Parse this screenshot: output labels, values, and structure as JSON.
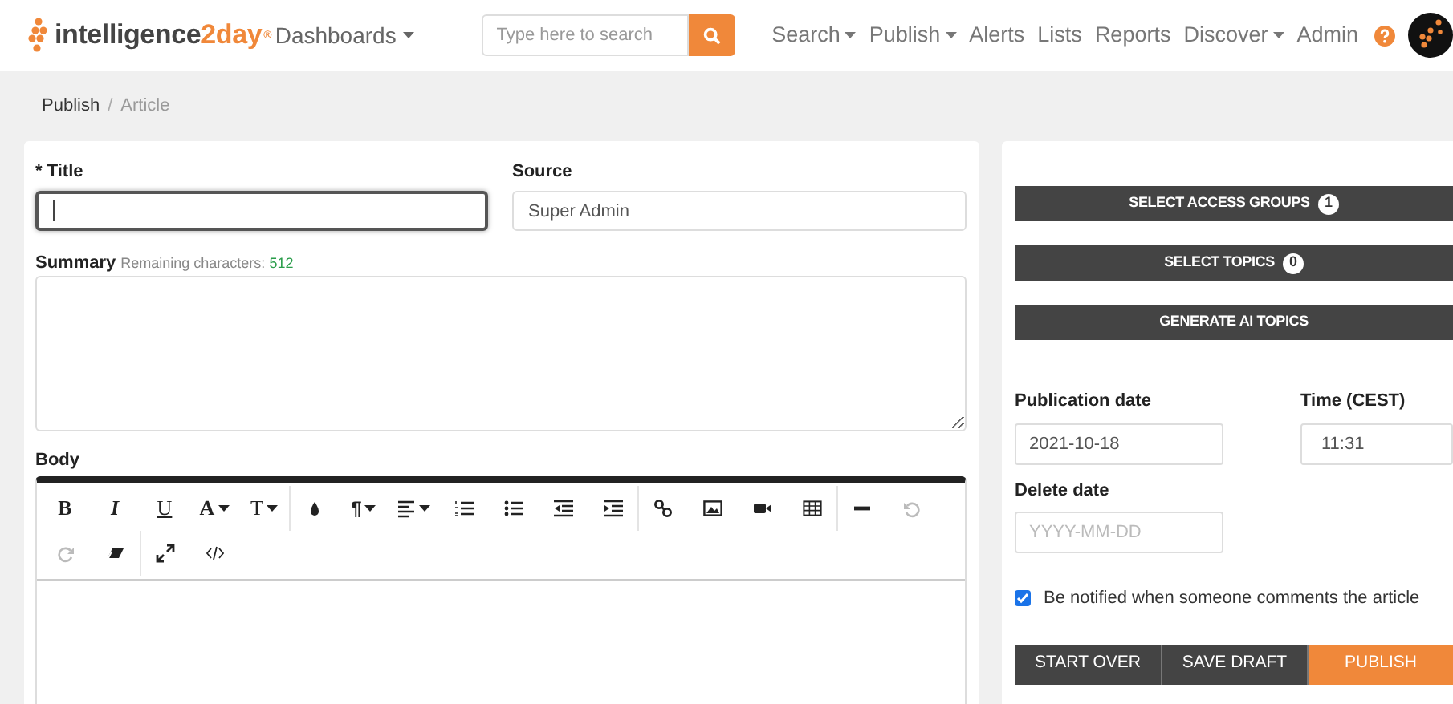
{
  "header": {
    "logo": {
      "text": "intelligence",
      "accent": "2day",
      "mark": "®"
    },
    "dashboards": {
      "label": "Dashboards",
      "dropdown": true
    },
    "search": {
      "placeholder": "Type here to search"
    },
    "nav": [
      {
        "label": "Search",
        "dropdown": true
      },
      {
        "label": "Publish",
        "dropdown": true
      },
      {
        "label": "Alerts",
        "dropdown": false
      },
      {
        "label": "Lists",
        "dropdown": false
      },
      {
        "label": "Reports",
        "dropdown": false
      },
      {
        "label": "Discover",
        "dropdown": true
      },
      {
        "label": "Admin",
        "dropdown": false
      }
    ]
  },
  "breadcrumb": {
    "separator": "/",
    "items": [
      {
        "label": "Publish",
        "current": false
      },
      {
        "label": "Article",
        "current": true
      }
    ]
  },
  "form": {
    "title": {
      "label": "* Title",
      "focused": true
    },
    "source": {
      "label": "Source",
      "value": "Super Admin"
    },
    "summary": {
      "label": "Summary",
      "hint": "Remaining characters:",
      "count": "512"
    },
    "body": {
      "label": "Body",
      "toolbar": [
        [
          {
            "kind": "bold",
            "glyph": "B",
            "dropdown": false,
            "disabled": false
          },
          {
            "kind": "italic",
            "glyph": "I",
            "dropdown": false,
            "disabled": false
          },
          {
            "kind": "underline",
            "glyph": "U",
            "dropdown": false,
            "disabled": false
          },
          {
            "kind": "fontcolor",
            "glyph": "A",
            "dropdown": true,
            "disabled": false
          },
          {
            "kind": "fontsize",
            "glyph": "T",
            "dropdown": true,
            "disabled": false
          }
        ],
        [
          {
            "kind": "drop",
            "dropdown": false,
            "disabled": false
          },
          {
            "kind": "paragraph",
            "glyph": "¶",
            "dropdown": true,
            "disabled": false
          },
          {
            "kind": "align",
            "dropdown": true,
            "disabled": false
          },
          {
            "kind": "ol",
            "dropdown": false,
            "disabled": false
          },
          {
            "kind": "ul",
            "dropdown": false,
            "disabled": false
          },
          {
            "kind": "outdent",
            "dropdown": false,
            "disabled": false
          },
          {
            "kind": "indent",
            "dropdown": false,
            "disabled": false
          }
        ],
        [
          {
            "kind": "link",
            "dropdown": false,
            "disabled": false
          },
          {
            "kind": "image",
            "dropdown": false,
            "disabled": false
          },
          {
            "kind": "video",
            "dropdown": false,
            "disabled": false
          },
          {
            "kind": "table",
            "dropdown": false,
            "disabled": false
          }
        ],
        [
          {
            "kind": "hr",
            "dropdown": false,
            "disabled": false
          },
          {
            "kind": "undo",
            "dropdown": false,
            "disabled": true
          },
          {
            "kind": "redo",
            "dropdown": false,
            "disabled": true
          },
          {
            "kind": "eraser",
            "dropdown": false,
            "disabled": false
          }
        ],
        [
          {
            "kind": "fullscreen",
            "dropdown": false,
            "disabled": false
          },
          {
            "kind": "code",
            "dropdown": false,
            "disabled": false
          }
        ]
      ]
    }
  },
  "side": {
    "buttons": [
      {
        "label": "SELECT ACCESS GROUPS",
        "count": "1"
      },
      {
        "label": "SELECT TOPICS",
        "count": "0"
      },
      {
        "label": "GENERATE AI TOPICS"
      }
    ],
    "publication_date": {
      "label": "Publication date",
      "value": "2021-10-18"
    },
    "time": {
      "label": "Time (CEST)",
      "value": "11:31"
    },
    "delete_date": {
      "label": "Delete date",
      "placeholder": "YYYY-MM-DD"
    },
    "notify": {
      "label": "Be notified when someone comments the article",
      "checked": true
    },
    "actions": [
      {
        "label": "START OVER",
        "primary": false
      },
      {
        "label": "SAVE DRAFT",
        "primary": false
      },
      {
        "label": "PUBLISH",
        "primary": true
      }
    ]
  }
}
